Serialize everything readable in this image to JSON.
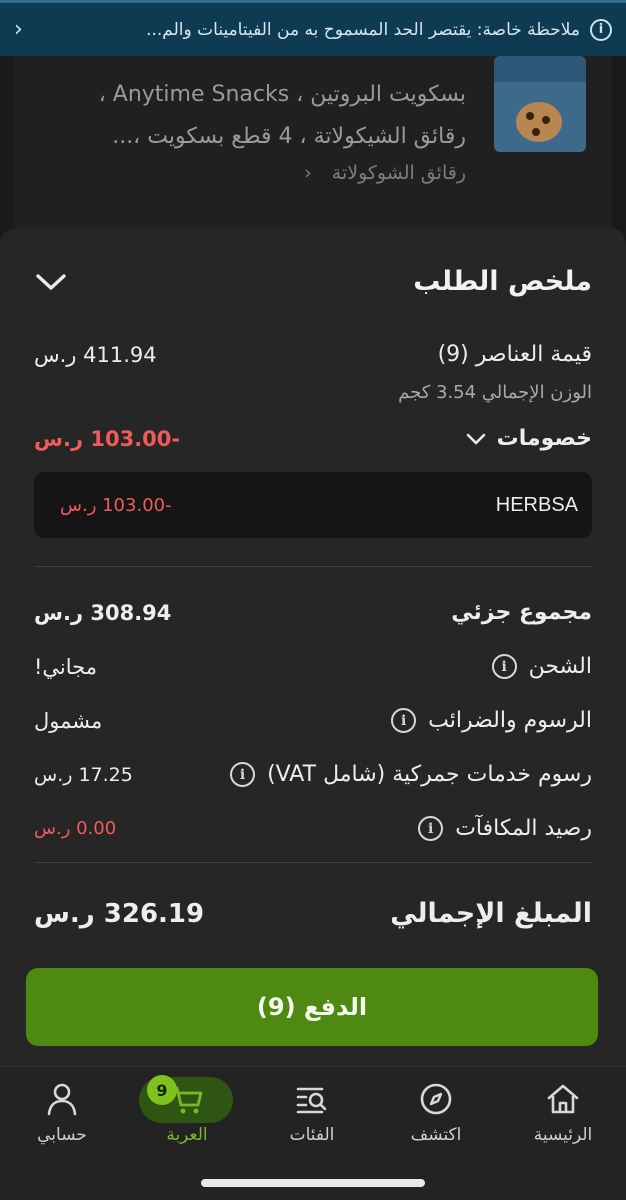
{
  "notice": {
    "text": "ملاحظة خاصة: يقتصر الحد المسموح به من الفيتامينات والم...",
    "icon": "info-icon",
    "chevron": "chevron-left-icon"
  },
  "product": {
    "name": "بسكويت البروتين ، Anytime Snacks ، رقائق الشيكولاتة ، 4 قطع بسكويت ،...",
    "variant": "رقائق الشوكولاتة"
  },
  "summary": {
    "title": "ملخص الطلب",
    "items_label": "قيمة العناصر (9)",
    "items_value": "411.94 ر.س",
    "weight": "الوزن الإجمالي 3.54 كجم",
    "discounts_label": "خصومات",
    "discounts_value": "-103.00 ر.س",
    "coupon_code": "HERBSA",
    "coupon_value": "-103.00 ر.س",
    "subtotal_label": "مجموع جزئي",
    "subtotal_value": "308.94 ر.س",
    "shipping_label": "الشحن",
    "shipping_value": "مجاني!",
    "fees_label": "الرسوم والضرائب",
    "fees_value": "مشمول",
    "customs_label": "رسوم خدمات جمركية (شامل VAT)",
    "customs_value": "17.25 ر.س",
    "rewards_label": "رصيد المكافآت",
    "rewards_value": "0.00 ر.س",
    "total_label": "المبلغ الإجمالي",
    "total_value": "326.19 ر.س",
    "pay_button": "الدفع (9)"
  },
  "nav": {
    "home": "الرئيسية",
    "explore": "اكتشف",
    "categories": "الفئات",
    "cart": "العربة",
    "cart_count": "9",
    "account": "حسابي"
  },
  "colors": {
    "accent": "#4e8a12",
    "active_nav": "#78b82a",
    "negative": "#f05a5a",
    "notice_bg": "#0f3b52"
  }
}
